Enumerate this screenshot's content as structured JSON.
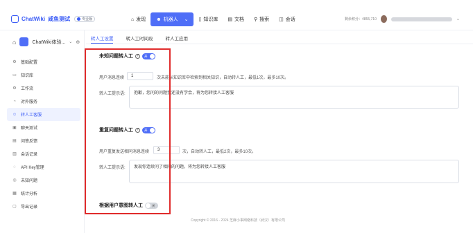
{
  "header": {
    "brand": "ChatWiki",
    "brand_sub": "咸鱼测试",
    "version_badge": "专业版",
    "nav": [
      {
        "label": "发现",
        "icon": "home-icon"
      },
      {
        "label": "机器人",
        "icon": "robot-icon"
      },
      {
        "label": "知识库",
        "icon": "book-icon"
      },
      {
        "label": "文档",
        "icon": "doc-icon"
      },
      {
        "label": "搜索",
        "icon": "search-icon"
      },
      {
        "label": "会话",
        "icon": "chat-icon"
      }
    ],
    "usage_text": "剩余积分：4855,710"
  },
  "sidebar": {
    "app_name": "ChatWiki体验...",
    "items": [
      {
        "label": "基础配置",
        "icon": "⚙"
      },
      {
        "label": "知识库",
        "icon": "▭"
      },
      {
        "label": "工作流",
        "icon": "⚙"
      },
      {
        "label": "对外服务",
        "icon": "◔"
      },
      {
        "label": "转人工客服",
        "icon": "☺"
      },
      {
        "label": "聊天测试",
        "icon": "▣"
      },
      {
        "label": "问答反馈",
        "icon": "▤"
      },
      {
        "label": "会话记录",
        "icon": "▥"
      },
      {
        "label": "API Key管理",
        "icon": "◌"
      },
      {
        "label": "未知问题",
        "icon": "◎"
      },
      {
        "label": "统计分析",
        "icon": "▦"
      },
      {
        "label": "导出记录",
        "icon": "▢"
      }
    ]
  },
  "tabs": [
    "转人工设置",
    "转人工时间段",
    "转人工应用"
  ],
  "sections": {
    "unknown": {
      "title": "未知问题转人工",
      "toggle": "开",
      "label": "用户消息连续",
      "value": "1",
      "desc": "次未能从知识库中检索到相关知识，自动转人工，最低1次，最多10次。",
      "prompt_label": "转人工提示语:",
      "prompt_text": "抱歉，您问的问题我还没有学会，将为您转接人工客服"
    },
    "repeat": {
      "title": "重复问题转人工",
      "toggle": "开",
      "label": "用户重复发送相同消息连续",
      "value": "3",
      "desc": "次，自动转人工，最低2次，最多10次。",
      "prompt_label": "转人工提示语:",
      "prompt_text": "发现你连续问了相同的问题，将为您转接人工客服"
    },
    "intent": {
      "title": "根据用户意图转人工",
      "toggle": "关"
    }
  },
  "footer": "Copyright © 2016 - 2024 芝麻小事网络科技（武汉）有限公司"
}
